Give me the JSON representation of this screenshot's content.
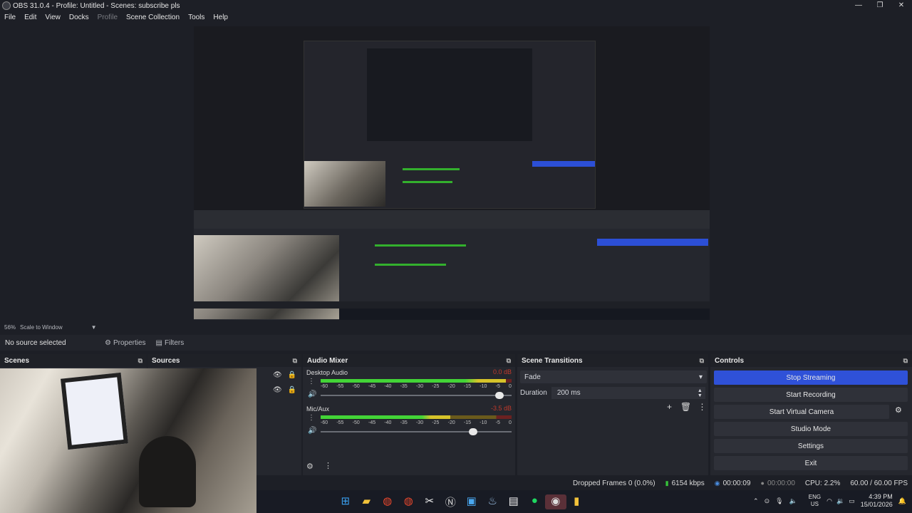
{
  "window": {
    "title": "OBS 31.0.4 - Profile: Untitled - Scenes: subscribe pls",
    "controls": [
      "—",
      "❐",
      "✕"
    ]
  },
  "menu": [
    "File",
    "Edit",
    "View",
    "Docks",
    "Profile",
    "Scene Collection",
    "Tools",
    "Help"
  ],
  "preview": {
    "zoom": "56%",
    "scale_mode": "Scale to Window"
  },
  "source_toolbar": {
    "selection": "No source selected",
    "properties": "Properties",
    "filters": "Filters"
  },
  "docks": {
    "scenes": "Scenes",
    "sources": "Sources",
    "audio_mixer": "Audio Mixer",
    "scene_transitions": "Scene Transitions",
    "controls": "Controls"
  },
  "audio_mixer": {
    "channels": [
      {
        "name": "Desktop Audio",
        "db": "0.0 dB",
        "level": 0.97,
        "volume": 0.96
      },
      {
        "name": "Mic/Aux",
        "db": "-3.5 dB",
        "level": 0.68,
        "volume": 0.82
      }
    ],
    "ticks": [
      "-60",
      "-55",
      "-50",
      "-45",
      "-40",
      "-35",
      "-30",
      "-25",
      "-20",
      "-15",
      "-10",
      "-5",
      "0"
    ]
  },
  "transitions": {
    "selected": "Fade",
    "duration_label": "Duration",
    "duration_value": "200 ms"
  },
  "controls": {
    "stop_streaming": "Stop Streaming",
    "start_recording": "Start Recording",
    "start_virtual_camera": "Start Virtual Camera",
    "studio_mode": "Studio Mode",
    "settings": "Settings",
    "exit": "Exit"
  },
  "status": {
    "dropped_frames": "Dropped Frames 0 (0.0%)",
    "bitrate": "6154 kbps",
    "stream_time": "00:00:09",
    "rec_time": "00:00:00",
    "cpu": "CPU: 2.2%",
    "fps": "60.00 / 60.00 FPS"
  },
  "system_tray": {
    "lang_top": "ENG",
    "lang_bottom": "US",
    "time": "4:39 PM",
    "date": "15/01/2026"
  },
  "colors": {
    "accent": "#2f51d8",
    "meter_green": "#43d437",
    "meter_yellow": "#d6c32a",
    "meter_red": "#c0392b",
    "background": "#1d1f26",
    "dock": "#25272e"
  }
}
